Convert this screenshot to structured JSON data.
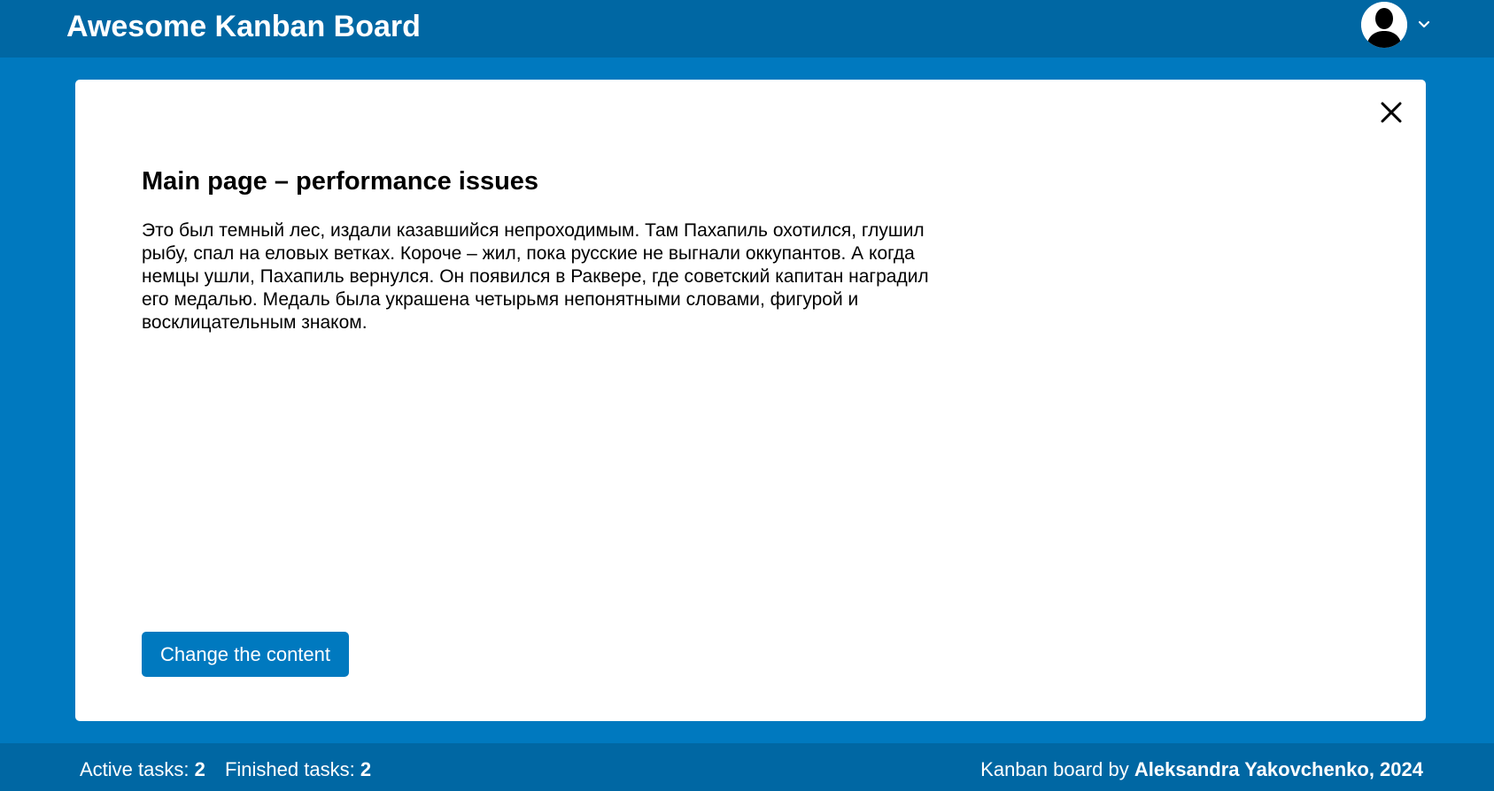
{
  "header": {
    "title": "Awesome Kanban Board",
    "avatar_icon": "user-silhouette-icon",
    "menu_icon": "chevron-down-icon"
  },
  "task": {
    "title": "Main page – performance issues",
    "description": "Это был темный лес, издали казавшийся непроходимым. Там Пахапиль охотился, глушил рыбу, спал на еловых ветках. Короче – жил, пока русские не выгнали оккупантов. А когда немцы ушли, Пахапиль вернулся. Он появился в Раквере, где советский капитан наградил его медалью. Медаль была украшена четырьмя непонятными словами, фигурой и восклицательным знаком.",
    "close_icon": "close-icon",
    "change_button_label": "Change the content"
  },
  "footer": {
    "active_label": "Active tasks: ",
    "active_count": "2",
    "finished_label": "Finished tasks: ",
    "finished_count": "2",
    "credit_prefix": "Kanban board by ",
    "credit_author": "Aleksandra Yakovchenko, 2024"
  },
  "colors": {
    "page_background": "#0079bf",
    "header_footer": "#0067a3",
    "card": "#ffffff",
    "button": "#0079bf"
  }
}
